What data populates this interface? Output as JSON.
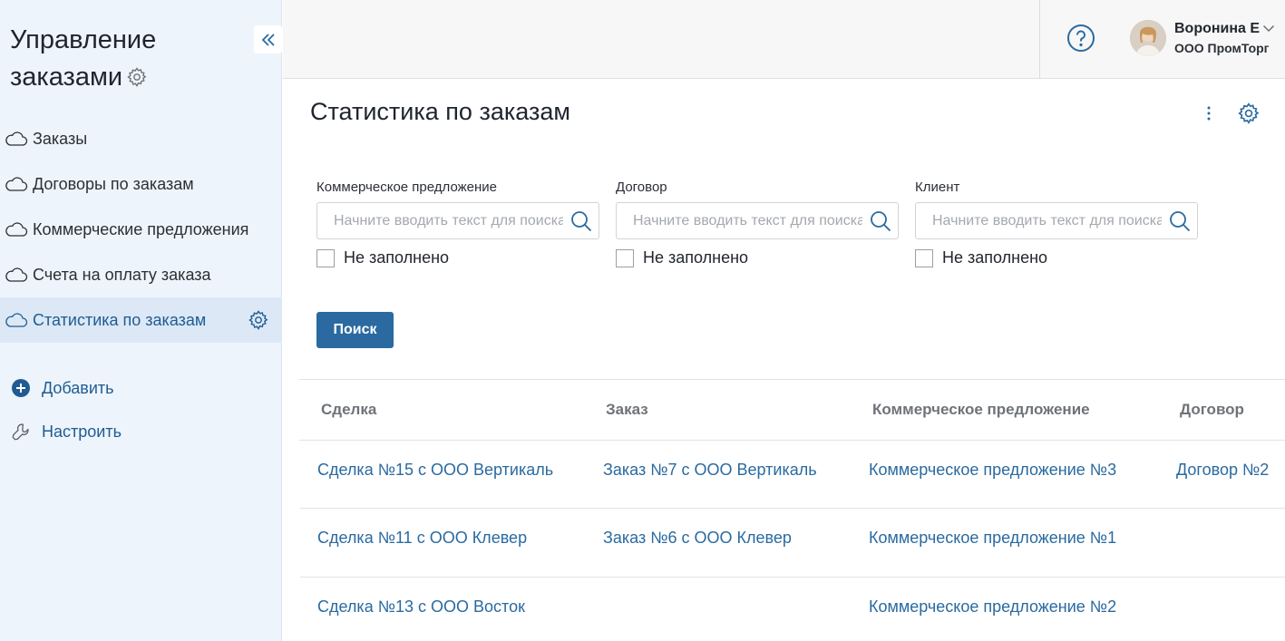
{
  "sidebar": {
    "title_line1": "Управление",
    "title_line2": "заказами",
    "items": [
      {
        "label": "Заказы"
      },
      {
        "label": "Договоры по заказам"
      },
      {
        "label": "Коммерческие предложения"
      },
      {
        "label": "Счета на оплату заказа"
      },
      {
        "label": "Статистика по заказам",
        "active": true
      }
    ],
    "actions": {
      "add_label": "Добавить",
      "configure_label": "Настроить"
    }
  },
  "header": {
    "user_name": "Воронина Е",
    "user_company": "ООО ПромТорг"
  },
  "page": {
    "title": "Статистика по заказам"
  },
  "filters": [
    {
      "label": "Коммерческое предложение",
      "placeholder": "Начните вводить текст для поиска",
      "empty_label": "Не заполнено"
    },
    {
      "label": "Договор",
      "placeholder": "Начните вводить текст для поиска",
      "empty_label": "Не заполнено"
    },
    {
      "label": "Клиент",
      "placeholder": "Начните вводить текст для поиска",
      "empty_label": "Не заполнено"
    }
  ],
  "search_button": "Поиск",
  "table": {
    "columns": [
      "Сделка",
      "Заказ",
      "Коммерческое предложение",
      "Договор"
    ],
    "rows": [
      [
        "Сделка №15 с ООО Вертикаль",
        "Заказ №7 с ООО Вертикаль",
        "Коммерческое предложение №3",
        "Договор №2"
      ],
      [
        "Сделка №11 с ООО Клевер",
        "Заказ №6 с ООО Клевер",
        "Коммерческое предложение №1",
        ""
      ],
      [
        "Сделка №13 с ООО Восток",
        "",
        "Коммерческое предложение №2",
        ""
      ]
    ]
  },
  "colors": {
    "accent": "#2a6aa0",
    "sidebar_bg": "#eef4fb",
    "sidebar_active_bg": "#dce8f5"
  }
}
